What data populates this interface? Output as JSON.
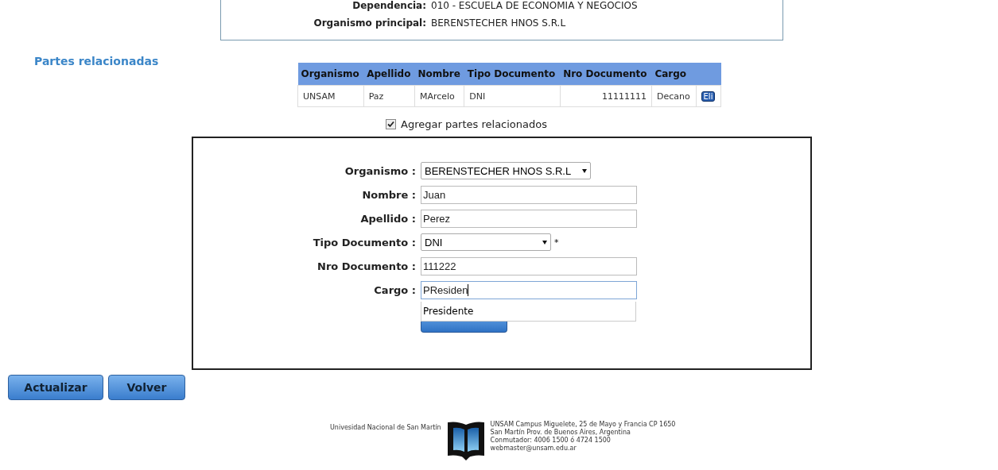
{
  "info": [
    {
      "label": "Dependencia:",
      "value": "010 - ESCUELA DE ECONOMIA Y NEGOCIOS"
    },
    {
      "label": "Organismo principal:",
      "value": "BERENSTECHER HNOS S.R.L"
    }
  ],
  "section_title": "Partes relacionadas",
  "table": {
    "columns": [
      "Organismo",
      "Apellido",
      "Nombre",
      "Tipo Documento",
      "Nro Documento",
      "Cargo"
    ],
    "rows": [
      {
        "cells": [
          "UNSAM",
          "Paz",
          "MArcelo",
          "DNI",
          "11111111",
          "Decano"
        ],
        "action": "Eli"
      }
    ]
  },
  "add_checkbox": {
    "label": "Agregar partes relacionados",
    "checked": true
  },
  "form": {
    "fields": [
      {
        "kind": "select",
        "label": "Organismo :",
        "value": "BERENSTECHER HNOS S.R.L"
      },
      {
        "kind": "text",
        "label": "Nombre :",
        "value": "Juan"
      },
      {
        "kind": "text",
        "label": "Apellido :",
        "value": "Perez"
      },
      {
        "kind": "select",
        "label": "Tipo Documento :",
        "value": "DNI",
        "required_mark": "*"
      },
      {
        "kind": "text",
        "label": "Nro Documento :",
        "value": "111222"
      },
      {
        "kind": "text",
        "label": "Cargo :",
        "value": "PResiden",
        "focused": true,
        "suggestions": [
          "Presidente"
        ]
      }
    ]
  },
  "buttons": [
    "Actualizar",
    "Volver"
  ],
  "footer": {
    "left": "Univesidad Nacional de San Martín",
    "right": [
      "UNSAM Campus Miguelete, 25 de Mayo y Francia CP 1650",
      "San Martín Prov. de Buenos Aires, Argentina",
      "Conmutador: 4006 1500 ó 4724 1500",
      "webmaster@unsam.edu.ar"
    ]
  }
}
